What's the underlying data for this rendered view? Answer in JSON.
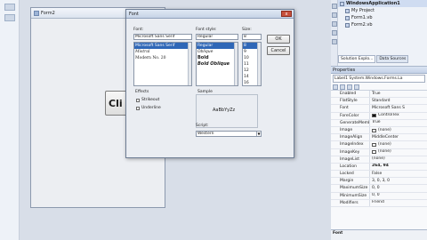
{
  "form": {
    "title": "Form2",
    "button_text": "Cli"
  },
  "dialog": {
    "title": "Font",
    "close": "x",
    "font_label": "Font:",
    "font_value": "Microsoft Sans Serif",
    "font_list": [
      "Microsoft Sans Serif",
      "Mistral",
      "Modern No. 20"
    ],
    "style_label": "Font style:",
    "style_value": "Regular",
    "style_list": [
      "Regular",
      "Oblique",
      "Bold",
      "Bold Oblique"
    ],
    "size_label": "Size:",
    "size_value": "8",
    "size_list": [
      "8",
      "9",
      "10",
      "11",
      "12",
      "14",
      "16"
    ],
    "ok": "OK",
    "cancel": "Cancel",
    "effects_label": "Effects",
    "strikeout": "Strikeout",
    "underline": "Underline",
    "sample_label": "Sample",
    "sample_text": "AaBbYyZz",
    "script_label": "Script:",
    "script_value": "Western"
  },
  "solution": {
    "items": [
      {
        "label": "WindowsApplication1",
        "icon": "project-icon"
      },
      {
        "label": "My Project",
        "icon": "folder-icon"
      },
      {
        "label": "Form1.vb",
        "icon": "form-icon"
      },
      {
        "label": "Form2.vb",
        "icon": "form-icon"
      }
    ]
  },
  "tabs": [
    "Solution Explo...",
    "Data Sources"
  ],
  "properties": {
    "title": "Properties",
    "target": "Label1 System.Windows.Forms.La",
    "rows": [
      {
        "name": "Enabled",
        "value": "True"
      },
      {
        "name": "FlatStyle",
        "value": "Standard"
      },
      {
        "name": "Font",
        "value": "Microsoft Sans S"
      },
      {
        "name": "ForeColor",
        "value": "ControlTex",
        "swatch": "#111111"
      },
      {
        "name": "GenerateMemb",
        "value": "True"
      },
      {
        "name": "Image",
        "value": "(none)",
        "swatch": "#ffffff"
      },
      {
        "name": "ImageAlign",
        "value": "MiddleCenter"
      },
      {
        "name": "ImageIndex",
        "value": "(none)",
        "swatch": "#ffffff"
      },
      {
        "name": "ImageKey",
        "value": "(none)",
        "swatch": "#ffffff"
      },
      {
        "name": "ImageList",
        "value": "(none)"
      },
      {
        "name": "Location",
        "value": "264, 94",
        "bold": true
      },
      {
        "name": "Locked",
        "value": "False"
      },
      {
        "name": "Margin",
        "value": "3, 0, 3, 0"
      },
      {
        "name": "MaximumSize",
        "value": "0, 0"
      },
      {
        "name": "MinimumSize",
        "value": "0, 0"
      },
      {
        "name": "Modifiers",
        "value": "Friend"
      }
    ],
    "desc_title": "Font"
  },
  "colors": {
    "selection": "#2f67b7",
    "close": "#c7503c"
  }
}
